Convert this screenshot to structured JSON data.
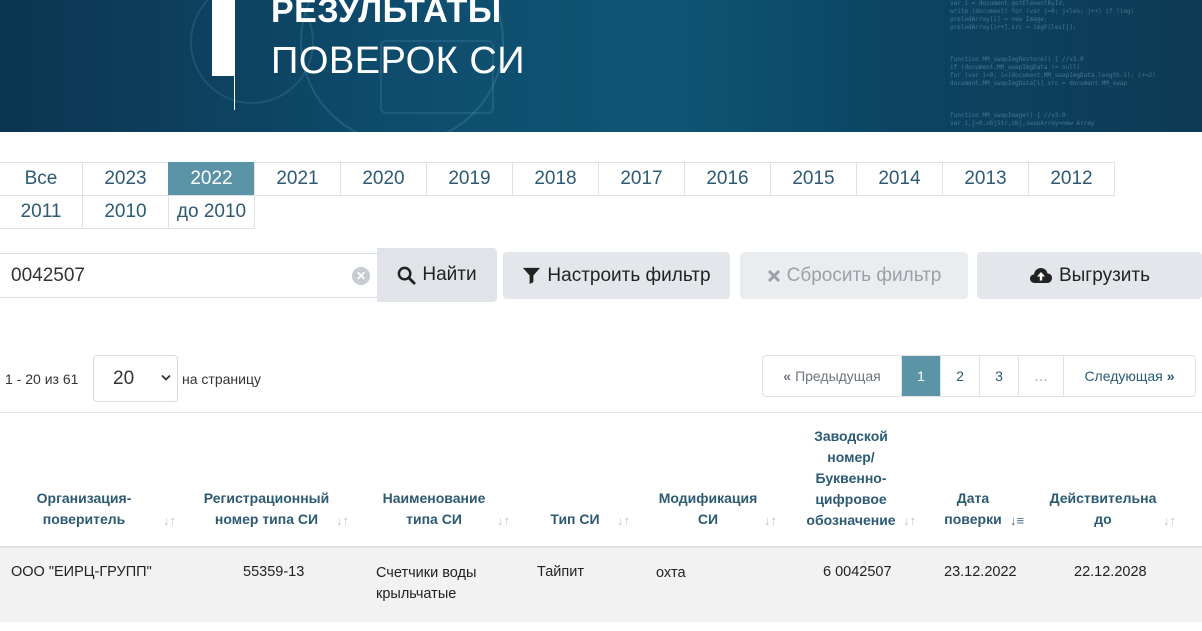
{
  "banner": {
    "title_line1": "РЕЗУЛЬТАТЫ",
    "title_line2": "ПОВЕРОК СИ"
  },
  "years": {
    "row1": [
      "Все",
      "2023",
      "2022",
      "2021",
      "2020",
      "2019",
      "2018",
      "2017",
      "2016",
      "2015",
      "2014",
      "2013",
      "2012"
    ],
    "row2": [
      "2011",
      "2010",
      "до 2010"
    ],
    "active": "2022"
  },
  "search": {
    "value": "0042507"
  },
  "buttons": {
    "find": "Найти",
    "filter": "Настроить фильтр",
    "reset": "Сбросить фильтр",
    "export": "Выгрузить"
  },
  "pager": {
    "range": "1 - 20 из 61",
    "per_page": "20",
    "per_page_label": "на страницу",
    "prev": "Предыдущая",
    "pages": [
      "1",
      "2",
      "3"
    ],
    "dots": "…",
    "next": "Следующая",
    "current": "1"
  },
  "table": {
    "headers": {
      "org": [
        "Организация-",
        "поверитель"
      ],
      "reg": [
        "Регистрационный",
        "номер типа СИ"
      ],
      "name": [
        "Наименование",
        "типа СИ"
      ],
      "type": [
        "Тип СИ"
      ],
      "mod": [
        "Модификация",
        "СИ"
      ],
      "serial": [
        "Заводской",
        "номер/",
        "Буквенно-",
        "цифровое",
        "обозначение"
      ],
      "date": [
        "Дата",
        "поверки"
      ],
      "valid": [
        "Действительна",
        "до"
      ]
    },
    "rows": [
      {
        "org": "ООО \"ЕИРЦ-ГРУПП\"",
        "reg": "55359-13",
        "name1": "Счетчики воды",
        "name2": "крыльчатые",
        "type": "Тайпит",
        "mod": "охта",
        "serial": "6 0042507",
        "date": "23.12.2022",
        "valid": "22.12.2028"
      }
    ]
  },
  "colors": {
    "accent": "#5b93a7",
    "header_text": "#2c5a73",
    "banner": "#0f4d6e"
  }
}
